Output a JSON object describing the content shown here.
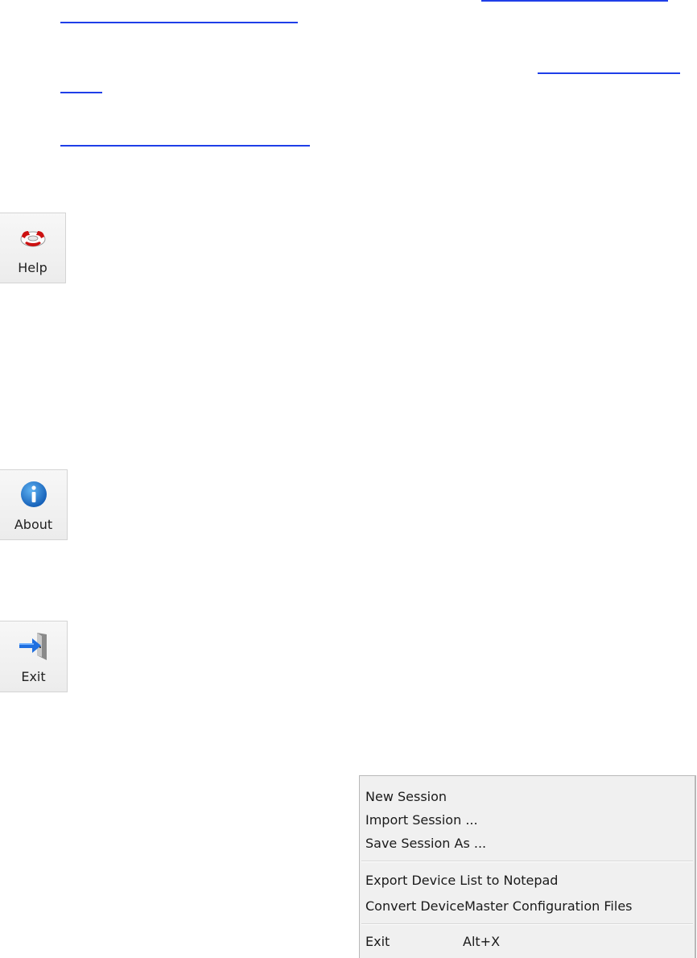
{
  "toolbar": {
    "help_label": "Help",
    "about_label": "About",
    "exit_label": "Exit"
  },
  "menu": {
    "items": [
      {
        "label": "New Session"
      },
      {
        "label": "Import Session ..."
      },
      {
        "label": "Save Session As ..."
      },
      {
        "label": "Export Device List to Notepad"
      },
      {
        "label": "Convert DeviceMaster Configuration Files"
      },
      {
        "label": "Exit",
        "shortcut": "Alt+X"
      }
    ]
  },
  "colors": {
    "link": "#1f3fe8",
    "menu_bg": "#f0f0f0",
    "help_icon_red": "#cc1111",
    "about_icon_blue": "#1a7fd6"
  },
  "icons": {
    "help": "lifebuoy-icon",
    "about": "info-icon",
    "exit": "exit-door-arrow-icon"
  }
}
